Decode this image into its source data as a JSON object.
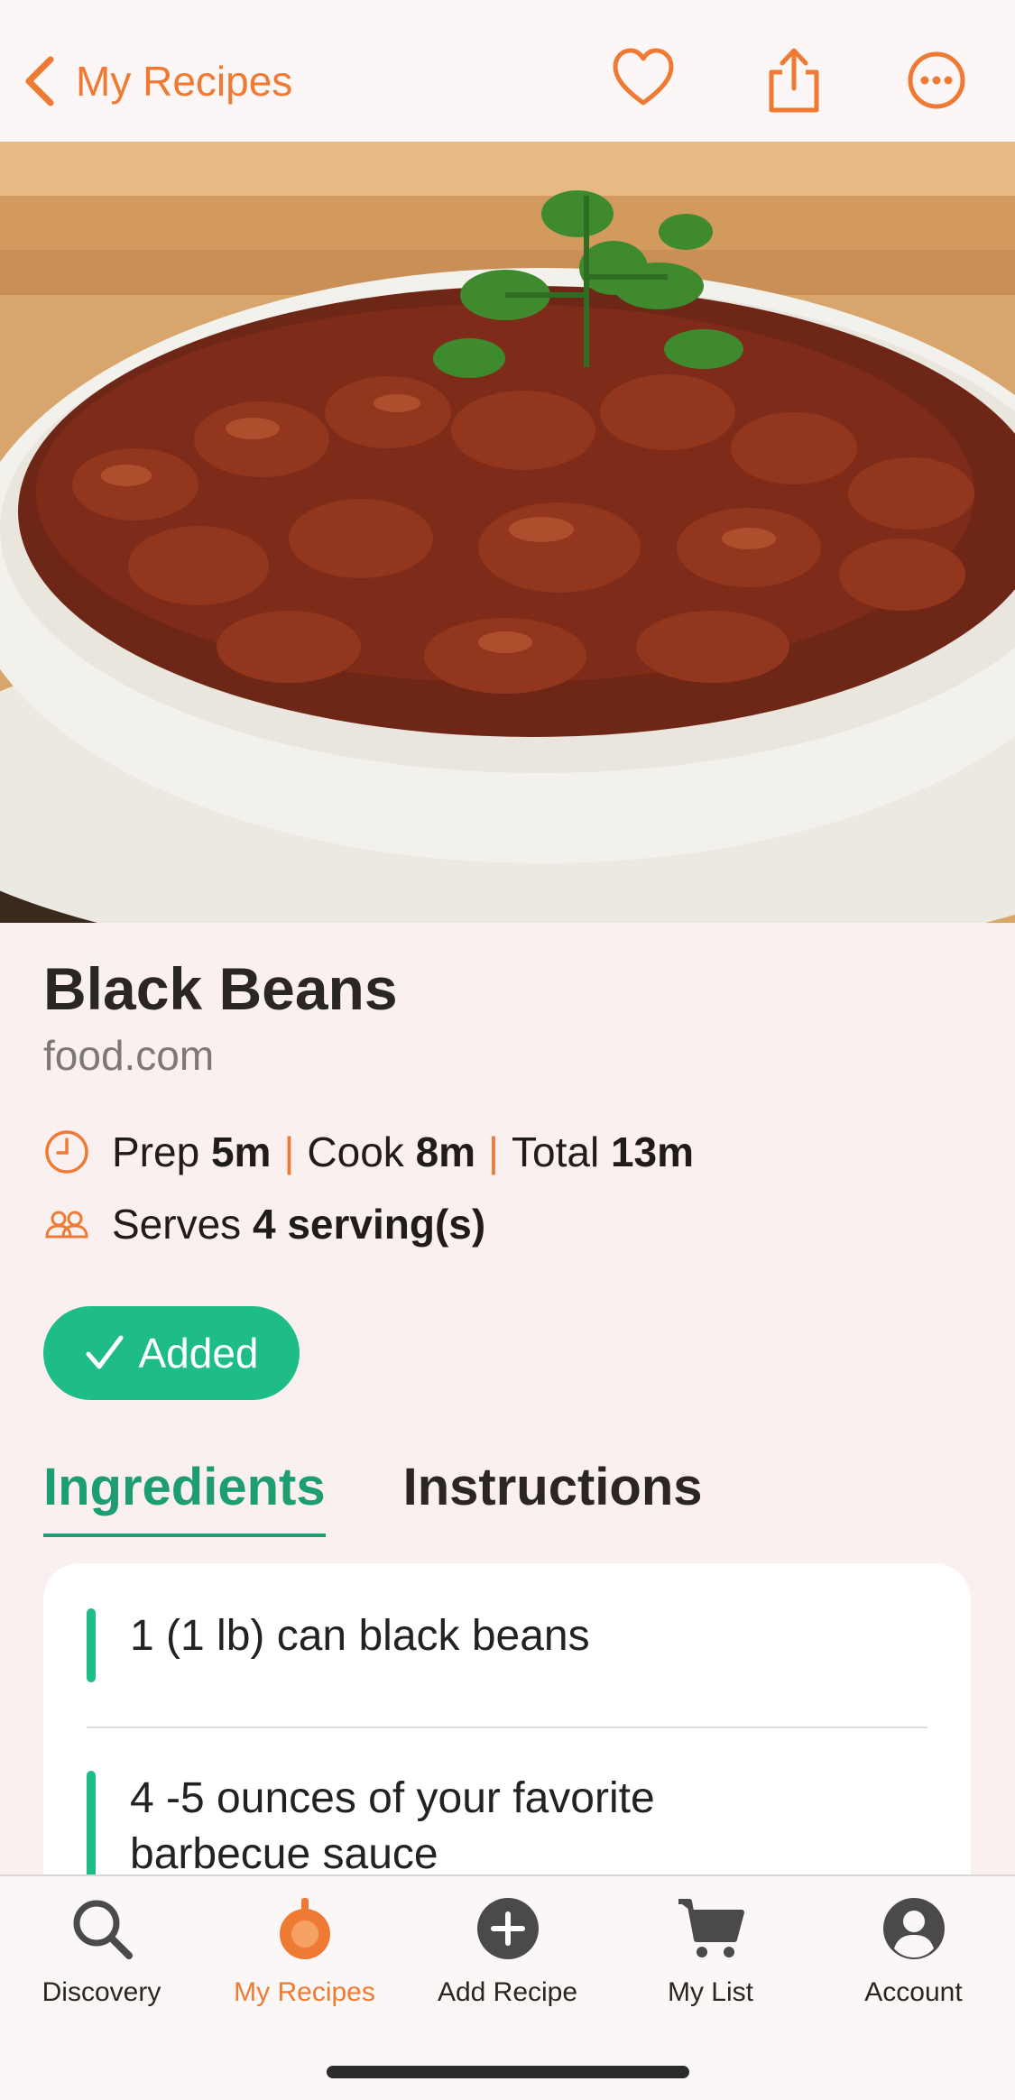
{
  "colors": {
    "accent": "#ee7a33",
    "green": "#1ebd87",
    "dark_green": "#1d9d72"
  },
  "nav": {
    "back_label": "My Recipes",
    "icons": [
      "chevron-left-icon",
      "heart-icon",
      "share-icon",
      "more-icon"
    ]
  },
  "recipe": {
    "title": "Black Beans",
    "source": "food.com",
    "prep_label": "Prep",
    "prep_value": "5m",
    "cook_label": "Cook",
    "cook_value": "8m",
    "total_label": "Total",
    "total_value": "13m",
    "separator": "|",
    "serves_label": "Serves",
    "serves_value": "4 serving(s)",
    "added_label": "Added"
  },
  "tabs": {
    "ingredients": "Ingredients",
    "instructions": "Instructions"
  },
  "ingredients": [
    "1 (1 lb) can black beans",
    "4 -5 ounces of your favorite",
    "barbecue sauce"
  ],
  "tabbar": {
    "items": [
      {
        "label": "Discovery",
        "icon": "search-icon"
      },
      {
        "label": "My Recipes",
        "icon": "pot-icon"
      },
      {
        "label": "Add Recipe",
        "icon": "plus-circle-icon"
      },
      {
        "label": "My List",
        "icon": "cart-icon"
      },
      {
        "label": "Account",
        "icon": "user-icon"
      }
    ],
    "active": "My Recipes"
  }
}
